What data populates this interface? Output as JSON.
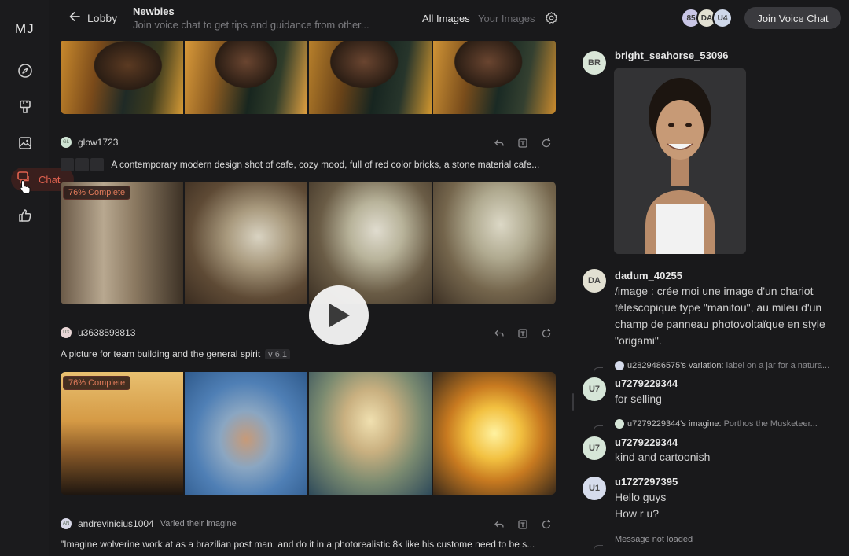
{
  "sidebar": {
    "logo": "MJ",
    "chat_label": "Chat"
  },
  "topbar": {
    "back_label": "Lobby",
    "channel_title": "Newbies",
    "channel_desc": "Join voice chat to get tips and guidance from other...",
    "tab_all": "All Images",
    "tab_yours": "Your Images",
    "avatars": [
      {
        "label": "85",
        "color": "#c9c6e6"
      },
      {
        "label": "DA",
        "color": "#e2e0d2"
      },
      {
        "label": "U4",
        "color": "#cfd8ea"
      }
    ],
    "join_label": "Join Voice Chat"
  },
  "feed": {
    "posts": [
      {
        "user": "glow1723",
        "avatar": "GL",
        "prompt": "A contemporary modern design shot of cafe, cozy mood, full of red color bricks, a stone material cafe...",
        "badge": "76% Complete"
      },
      {
        "user": "u3638598813",
        "avatar": "U3",
        "prompt": "A picture for team building and the general spirit",
        "version": "v 6.1",
        "badge": "76% Complete"
      },
      {
        "user": "andrevinicius1004",
        "avatar": "AN",
        "action": "Varied their imagine",
        "prompt": "\"Imagine wolverine work at as a brazilian post man. and do it in a photorealistic 8k like his custome need to be s..."
      }
    ]
  },
  "chat": {
    "messages": [
      {
        "avatar": "BR",
        "avatar_color": "#d9e6d8",
        "user": "bright_seahorse_53096"
      },
      {
        "avatar": "DA",
        "avatar_color": "#e2e0d2",
        "user": "dadum_40255",
        "lines": [
          "/image : crée moi une image d'un chariot",
          "télescopique type \"manitou\", au mileu d'un",
          "champ de panneau photovoltaïque en style",
          "\"origami\"."
        ]
      },
      {
        "avatar": "U7",
        "avatar_color": "#d6e6d8",
        "ref_user": "u2829486575's variation:",
        "ref_text": "label on a jar for a natura...",
        "user": "u7279229344",
        "lines": [
          "for selling"
        ]
      },
      {
        "avatar": "U7",
        "avatar_color": "#d6e6d8",
        "ref_user": "u7279229344's imagine:",
        "ref_text": "Porthos the Musketeer...",
        "user": "u7279229344",
        "lines": [
          "kind and cartoonish"
        ]
      },
      {
        "avatar": "U1",
        "avatar_color": "#d6dcec",
        "user": "u1727297395",
        "lines": [
          "Hello guys",
          "How r u?"
        ]
      },
      {
        "ref_note": "Message not loaded"
      }
    ]
  },
  "colors": {
    "accent": "#e0614f",
    "background": "#19191b"
  }
}
